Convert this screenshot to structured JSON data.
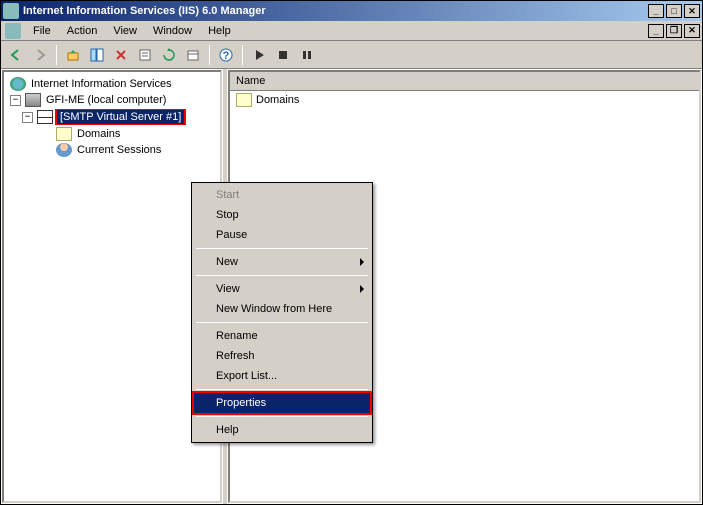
{
  "window": {
    "title": "Internet Information Services (IIS) 6.0 Manager"
  },
  "menu": {
    "file": "File",
    "action": "Action",
    "view": "View",
    "window": "Window",
    "help": "Help"
  },
  "tree": {
    "root": "Internet Information Services",
    "computer": "GFI-ME (local computer)",
    "smtp": "[SMTP Virtual Server #1]",
    "domains": "Domains",
    "sessions": "Current Sessions"
  },
  "list": {
    "header": "Name",
    "row1": "Domains"
  },
  "context_menu": {
    "start": "Start",
    "stop": "Stop",
    "pause": "Pause",
    "new": "New",
    "view": "View",
    "new_window": "New Window from Here",
    "rename": "Rename",
    "refresh": "Refresh",
    "export": "Export List...",
    "properties": "Properties",
    "help": "Help"
  }
}
